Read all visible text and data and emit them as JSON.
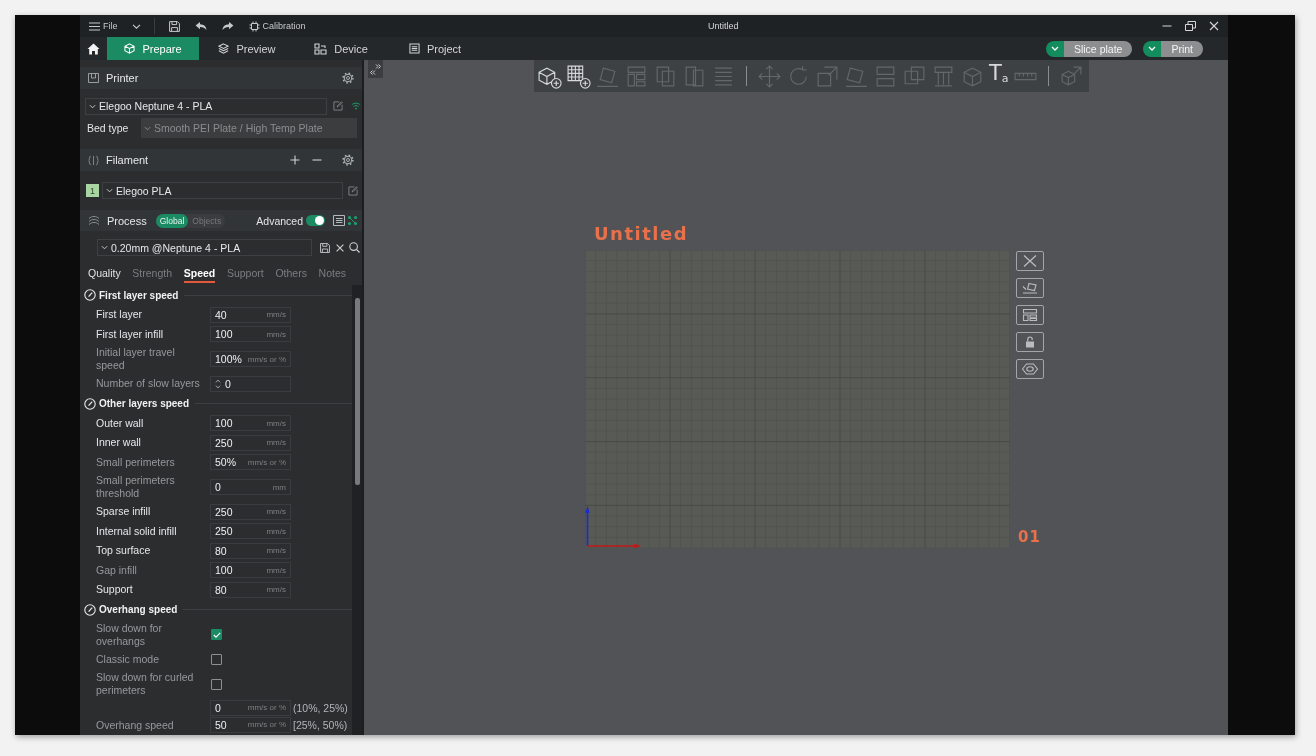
{
  "window": {
    "title": "Untitled"
  },
  "menu_bar": {
    "file_label": "File",
    "calibration_label": "Calibration"
  },
  "main_tabs": [
    {
      "label": "Prepare",
      "selected": true
    },
    {
      "label": "Preview",
      "selected": false
    },
    {
      "label": "Device",
      "selected": false
    },
    {
      "label": "Project",
      "selected": false
    }
  ],
  "actions": [
    {
      "label": "Slice plate"
    },
    {
      "label": "Print"
    }
  ],
  "sidebar": {
    "printer": {
      "title": "Printer",
      "preset": "Elegoo Neptune 4 - PLA",
      "bed_type_label": "Bed type",
      "bed_type": "Smooth PEI Plate / High Temp Plate"
    },
    "filament": {
      "title": "Filament",
      "items": [
        {
          "number": "1",
          "name": "Elegoo PLA",
          "color": "#a8d5a2"
        }
      ]
    },
    "process": {
      "title": "Process",
      "scopes": [
        {
          "label": "Global",
          "selected": true
        },
        {
          "label": "Objects",
          "selected": false
        }
      ],
      "advanced_label": "Advanced",
      "advanced": true,
      "preset": "0.20mm @Neptune 4 - PLA"
    },
    "setting_tabs": [
      {
        "label": "Quality",
        "selected": false,
        "dimmed": false
      },
      {
        "label": "Strength",
        "selected": false,
        "dimmed": true
      },
      {
        "label": "Speed",
        "selected": true,
        "dimmed": false
      },
      {
        "label": "Support",
        "selected": false,
        "dimmed": true
      },
      {
        "label": "Others",
        "selected": false,
        "dimmed": true
      },
      {
        "label": "Notes",
        "selected": false,
        "dimmed": true
      }
    ],
    "sections": [
      {
        "title": "First layer speed",
        "rows": [
          {
            "kind": "number",
            "label": "First layer",
            "value": "40",
            "unit": "mm/s",
            "dimmed": false
          },
          {
            "kind": "number",
            "label": "First layer infill",
            "value": "100",
            "unit": "mm/s",
            "dimmed": false
          },
          {
            "kind": "number",
            "label": "Initial layer travel speed",
            "value": "100%",
            "unit": "mm/s or %",
            "dimmed": true
          },
          {
            "kind": "spin",
            "label": "Number of slow layers",
            "value": "0",
            "dimmed": true
          }
        ]
      },
      {
        "title": "Other layers speed",
        "rows": [
          {
            "kind": "number",
            "label": "Outer wall",
            "value": "100",
            "unit": "mm/s",
            "dimmed": false
          },
          {
            "kind": "number",
            "label": "Inner wall",
            "value": "250",
            "unit": "mm/s",
            "dimmed": false
          },
          {
            "kind": "number",
            "label": "Small perimeters",
            "value": "50%",
            "unit": "mm/s or %",
            "dimmed": true
          },
          {
            "kind": "number",
            "label": "Small perimeters threshold",
            "value": "0",
            "unit": "mm",
            "dimmed": true
          },
          {
            "kind": "number",
            "label": "Sparse infill",
            "value": "250",
            "unit": "mm/s",
            "dimmed": false
          },
          {
            "kind": "number",
            "label": "Internal solid infill",
            "value": "250",
            "unit": "mm/s",
            "dimmed": false
          },
          {
            "kind": "number",
            "label": "Top surface",
            "value": "80",
            "unit": "mm/s",
            "dimmed": false
          },
          {
            "kind": "number",
            "label": "Gap infill",
            "value": "100",
            "unit": "mm/s",
            "dimmed": true
          },
          {
            "kind": "number",
            "label": "Support",
            "value": "80",
            "unit": "mm/s",
            "dimmed": false
          }
        ]
      },
      {
        "title": "Overhang speed",
        "rows": [
          {
            "kind": "checkbox",
            "label": "Slow down for overhangs",
            "checked": true,
            "dimmed": true
          },
          {
            "kind": "checkbox",
            "label": "Classic mode",
            "checked": false,
            "dimmed": true
          },
          {
            "kind": "checkbox",
            "label": "Slow down for curled perimeters",
            "checked": false,
            "dimmed": true
          },
          {
            "kind": "range_group",
            "label": "Overhang speed",
            "dimmed": true,
            "fields": [
              {
                "value": "0",
                "unit": "mm/s or %",
                "range": "(10%, 25%)"
              },
              {
                "value": "50",
                "unit": "mm/s or %",
                "range": "[25%, 50%)"
              }
            ]
          }
        ]
      }
    ]
  },
  "toolbar": [
    {
      "kind": "add_part",
      "disabled": false
    },
    {
      "kind": "add_plate",
      "disabled": false
    },
    {
      "kind": "orient",
      "disabled": true
    },
    {
      "kind": "arrange",
      "disabled": true
    },
    {
      "kind": "split_objects",
      "disabled": true
    },
    {
      "kind": "split_parts",
      "disabled": true
    },
    {
      "kind": "layers",
      "disabled": true
    },
    {
      "kind": "separator"
    },
    {
      "kind": "move",
      "disabled": true
    },
    {
      "kind": "rotate",
      "disabled": true
    },
    {
      "kind": "scale",
      "disabled": true
    },
    {
      "kind": "lay_flat",
      "disabled": true
    },
    {
      "kind": "cut",
      "disabled": true
    },
    {
      "kind": "boolean",
      "disabled": true
    },
    {
      "kind": "support_paint",
      "disabled": true
    },
    {
      "kind": "seam_paint",
      "disabled": true
    },
    {
      "kind": "text",
      "glyph": "T$_{a}$",
      "disabled": false
    },
    {
      "kind": "measure",
      "disabled": true
    },
    {
      "kind": "separator"
    },
    {
      "kind": "assembly",
      "disabled": true
    }
  ],
  "plate": {
    "title": "Untitled",
    "number": "01"
  }
}
